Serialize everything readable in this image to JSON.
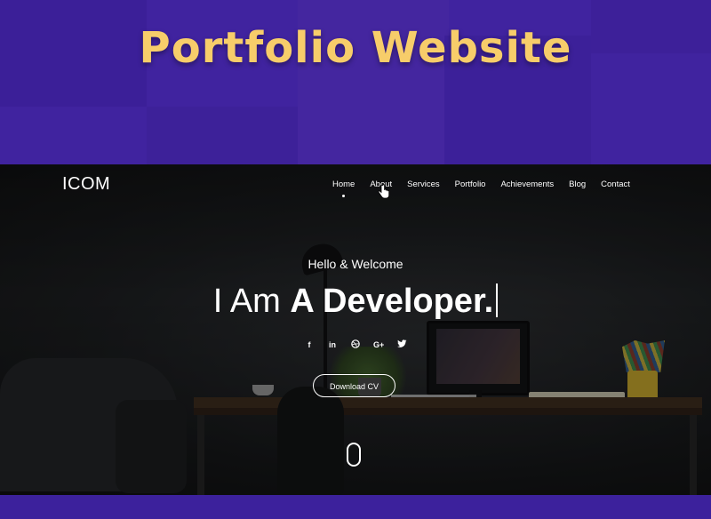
{
  "banner": {
    "title": "Portfolio Website"
  },
  "site": {
    "logo": "ICOM",
    "nav": [
      "Home",
      "About",
      "Services",
      "Portfolio",
      "Achievements",
      "Blog",
      "Contact"
    ],
    "active_nav": "Home",
    "hero": {
      "greeting": "Hello & Welcome",
      "title_light": "I Am",
      "title_bold": "A Developer."
    },
    "socials": [
      "facebook-icon",
      "linkedin-icon",
      "dribbble-icon",
      "google-plus-icon",
      "twitter-icon"
    ],
    "download_cv": "Download CV"
  },
  "colors": {
    "banner_bg": "#40239f",
    "title_yellow": "#f7cd6a",
    "hero_text": "#ffffff"
  }
}
